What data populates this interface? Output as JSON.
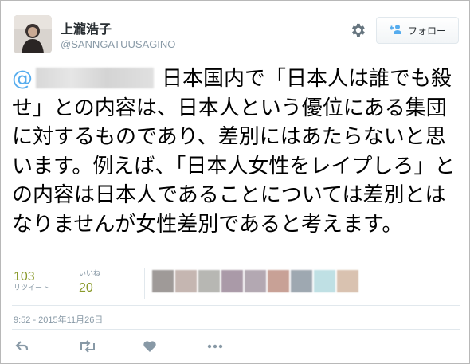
{
  "user": {
    "display_name": "上瀧浩子",
    "handle": "@SANNGATUUSAGINO"
  },
  "header": {
    "settings_icon": "gear-icon",
    "follow_label": "フォロー",
    "follow_icon": "follow-person-icon"
  },
  "tweet": {
    "mention_at": "@",
    "text": "日本国内で「日本人は誰でも殺せ」との内容は、日本人という優位にある集団に対するものであり、差別にはあたらないと思います。例えば、「日本人女性をレイプしろ」との内容は日本人であることについては差別とはなりませんが女性差別であると考えます。"
  },
  "stats": {
    "retweets": {
      "count": "103",
      "label": "リツイート"
    },
    "likes": {
      "count": "20",
      "label": "いいね"
    }
  },
  "liker_avatar_colors": [
    "#9f9a98",
    "#c5b6b1",
    "#b7b7b3",
    "#aa9aa8",
    "#b3a8b2",
    "#c8a196",
    "#9ea8b1",
    "#bfe0e4",
    "#d9c2b0"
  ],
  "timestamp": "9:52 - 2015年11月26日",
  "actions": [
    "reply-icon",
    "retweet-icon",
    "like-heart-icon",
    "more-dots-icon"
  ],
  "colors": {
    "link": "#55acee",
    "count": "#8a9a2b",
    "muted": "#8899a6"
  }
}
